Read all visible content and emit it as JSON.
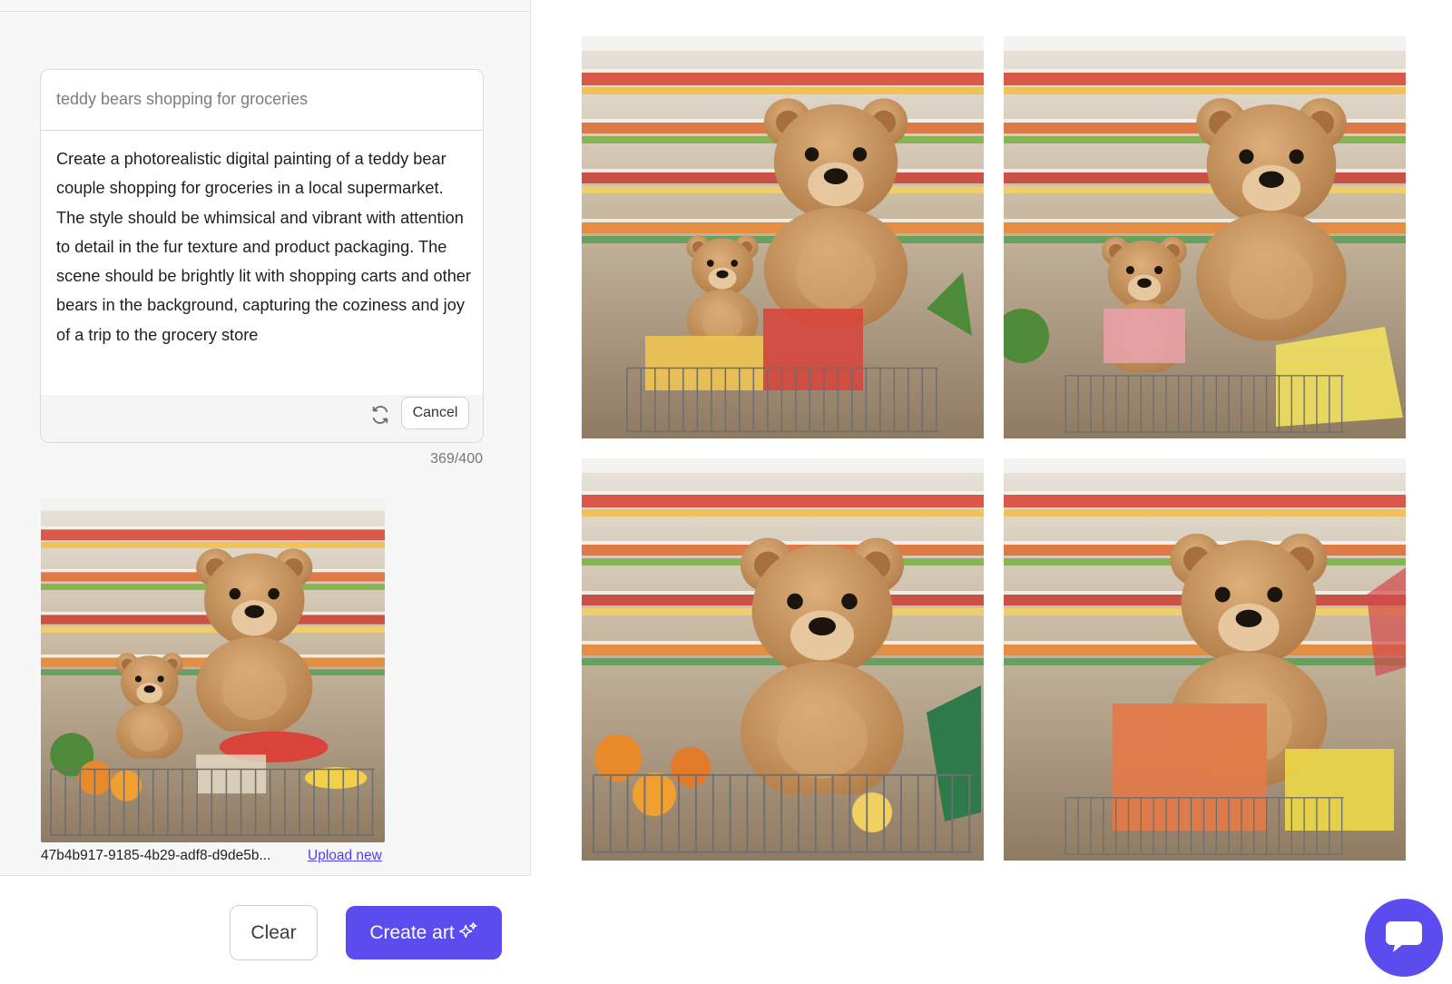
{
  "prompt": {
    "input_value": "teddy bears shopping for groceries",
    "expanded_text": "Create a photorealistic digital painting of a teddy bear couple shopping for groceries in a local supermarket. The style should be whimsical and vibrant with attention to detail in the fur texture and product packaging. The scene should be brightly lit with shopping carts and other bears in the background, capturing the coziness and joy of a trip to the grocery store",
    "cancel_label": "Cancel",
    "char_count": "369/400",
    "refresh_icon": "refresh-icon"
  },
  "upload": {
    "file_name": "47b4b917-9185-4b29-adf8-d9de5b...",
    "upload_label": "Upload new"
  },
  "actions": {
    "clear_label": "Clear",
    "create_label": "Create art",
    "create_icon": "sparkle-icon"
  },
  "results": {
    "images": [
      {
        "name": "generated-image-1"
      },
      {
        "name": "generated-image-2"
      },
      {
        "name": "generated-image-3"
      },
      {
        "name": "generated-image-4"
      }
    ]
  },
  "chat": {
    "icon": "chat-bubble-icon"
  },
  "colors": {
    "accent": "#5b4cf0",
    "link": "#4f3df0",
    "panel_bg": "#f7f7f7",
    "bear_fur": "#c8955c"
  }
}
